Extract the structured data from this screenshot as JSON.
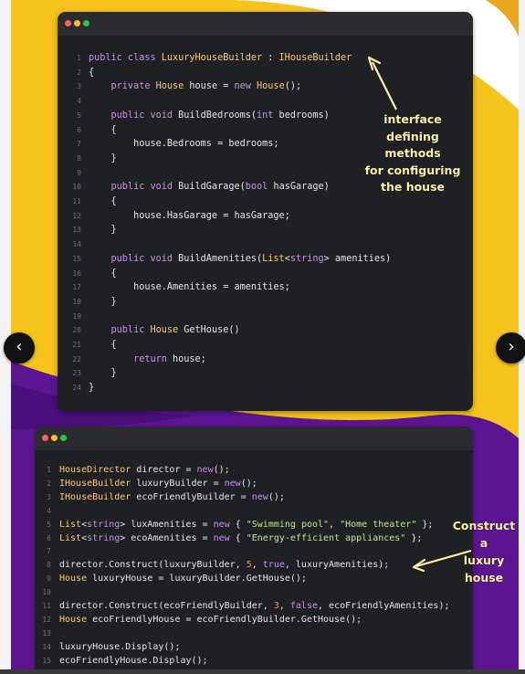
{
  "colors": {
    "yellow_bg": "#f6c21c",
    "purple_bg": "#5b1591",
    "editor_bg": "#1f2024"
  },
  "window1": {
    "lines": [
      {
        "n": "1",
        "segs": [
          [
            "kw",
            "public class "
          ],
          [
            "cls",
            "LuxuryHouseBuilder"
          ],
          [
            "fn",
            " : "
          ],
          [
            "cls",
            "IHouseBuilder"
          ]
        ]
      },
      {
        "n": "2",
        "segs": [
          [
            "fn",
            "{"
          ]
        ]
      },
      {
        "n": "3",
        "segs": [
          [
            "kw",
            "    private "
          ],
          [
            "cls",
            "House"
          ],
          [
            "fn",
            " house = "
          ],
          [
            "kw",
            "new "
          ],
          [
            "cls",
            "House"
          ],
          [
            "fn",
            "();"
          ]
        ]
      },
      {
        "n": "4",
        "segs": []
      },
      {
        "n": "5",
        "segs": [
          [
            "kw",
            "    public void "
          ],
          [
            "fn",
            "BuildBedrooms("
          ],
          [
            "kw",
            "int"
          ],
          [
            "fn",
            " bedrooms)"
          ]
        ]
      },
      {
        "n": "6",
        "segs": [
          [
            "fn",
            "    {"
          ]
        ]
      },
      {
        "n": "7",
        "segs": [
          [
            "fn",
            "        house.Bedrooms = bedrooms;"
          ]
        ]
      },
      {
        "n": "8",
        "segs": [
          [
            "fn",
            "    }"
          ]
        ]
      },
      {
        "n": "9",
        "segs": []
      },
      {
        "n": "10",
        "segs": [
          [
            "kw",
            "    public void "
          ],
          [
            "fn",
            "BuildGarage("
          ],
          [
            "kw",
            "bool"
          ],
          [
            "fn",
            " hasGarage)"
          ]
        ]
      },
      {
        "n": "11",
        "segs": [
          [
            "fn",
            "    {"
          ]
        ]
      },
      {
        "n": "12",
        "segs": [
          [
            "fn",
            "        house.HasGarage = hasGarage;"
          ]
        ]
      },
      {
        "n": "13",
        "segs": [
          [
            "fn",
            "    }"
          ]
        ]
      },
      {
        "n": "14",
        "segs": []
      },
      {
        "n": "15",
        "segs": [
          [
            "kw",
            "    public void "
          ],
          [
            "fn",
            "BuildAmenities("
          ],
          [
            "cls",
            "List"
          ],
          [
            "fn",
            "<"
          ],
          [
            "kw",
            "string"
          ],
          [
            "fn",
            "> amenities)"
          ]
        ]
      },
      {
        "n": "16",
        "segs": [
          [
            "fn",
            "    {"
          ]
        ]
      },
      {
        "n": "17",
        "segs": [
          [
            "fn",
            "        house.Amenities = amenities;"
          ]
        ]
      },
      {
        "n": "18",
        "segs": [
          [
            "fn",
            "    }"
          ]
        ]
      },
      {
        "n": "19",
        "segs": []
      },
      {
        "n": "20",
        "segs": [
          [
            "kw",
            "    public "
          ],
          [
            "cls",
            "House"
          ],
          [
            "fn",
            " GetHouse()"
          ]
        ]
      },
      {
        "n": "21",
        "segs": [
          [
            "fn",
            "    {"
          ]
        ]
      },
      {
        "n": "22",
        "segs": [
          [
            "kw",
            "        return"
          ],
          [
            "fn",
            " house;"
          ]
        ]
      },
      {
        "n": "23",
        "segs": [
          [
            "fn",
            "    }"
          ]
        ]
      },
      {
        "n": "24",
        "segs": [
          [
            "fn",
            "}"
          ]
        ]
      }
    ]
  },
  "window2": {
    "lines": [
      {
        "n": "1",
        "segs": [
          [
            "cls",
            "HouseDirector"
          ],
          [
            "fn",
            " director = "
          ],
          [
            "kw",
            "new"
          ],
          [
            "fn",
            "();"
          ]
        ]
      },
      {
        "n": "2",
        "segs": [
          [
            "cls",
            "IHouseBuilder"
          ],
          [
            "fn",
            " luxuryBuilder = "
          ],
          [
            "kw",
            "new"
          ],
          [
            "fn",
            "();"
          ]
        ]
      },
      {
        "n": "3",
        "segs": [
          [
            "cls",
            "IHouseBuilder"
          ],
          [
            "fn",
            " ecoFriendlyBuilder = "
          ],
          [
            "kw",
            "new"
          ],
          [
            "fn",
            "();"
          ]
        ]
      },
      {
        "n": "4",
        "segs": []
      },
      {
        "n": "5",
        "segs": [
          [
            "cls",
            "List"
          ],
          [
            "fn",
            "<"
          ],
          [
            "kw",
            "string"
          ],
          [
            "fn",
            "> luxAmenities = "
          ],
          [
            "kw",
            "new"
          ],
          [
            "fn",
            " { "
          ],
          [
            "st",
            "\"Swimming pool\""
          ],
          [
            "fn",
            ", "
          ],
          [
            "st",
            "\"Home theater\""
          ],
          [
            "fn",
            " };"
          ]
        ]
      },
      {
        "n": "6",
        "segs": [
          [
            "cls",
            "List"
          ],
          [
            "fn",
            "<"
          ],
          [
            "kw",
            "string"
          ],
          [
            "fn",
            "> ecoAmenities = "
          ],
          [
            "kw",
            "new"
          ],
          [
            "fn",
            " { "
          ],
          [
            "st",
            "\"Energy-efficient appliances\""
          ],
          [
            "fn",
            " };"
          ]
        ]
      },
      {
        "n": "7",
        "segs": []
      },
      {
        "n": "8",
        "segs": [
          [
            "fn",
            "director.Construct(luxuryBuilder, "
          ],
          [
            "num",
            "5"
          ],
          [
            "fn",
            ", "
          ],
          [
            "kw",
            "true"
          ],
          [
            "fn",
            ", luxuryAmenities);"
          ]
        ]
      },
      {
        "n": "9",
        "segs": [
          [
            "cls",
            "House"
          ],
          [
            "fn",
            " luxuryHouse = luxuryBuilder.GetHouse();"
          ]
        ]
      },
      {
        "n": "10",
        "segs": []
      },
      {
        "n": "11",
        "segs": [
          [
            "fn",
            "director.Construct(ecoFriendlyBuilder, "
          ],
          [
            "num",
            "3"
          ],
          [
            "fn",
            ", "
          ],
          [
            "kw",
            "false"
          ],
          [
            "fn",
            ", ecoFriendlyAmenities);"
          ]
        ]
      },
      {
        "n": "12",
        "segs": [
          [
            "cls",
            "House"
          ],
          [
            "fn",
            " ecoFriendlyHouse = ecoFriendlyBuilder.GetHouse();"
          ]
        ]
      },
      {
        "n": "13",
        "segs": []
      },
      {
        "n": "14",
        "segs": [
          [
            "fn",
            "luxuryHouse.Display();"
          ]
        ]
      },
      {
        "n": "15",
        "segs": [
          [
            "fn",
            "ecoFriendlyHouse.Display();"
          ]
        ]
      }
    ]
  },
  "annotations": {
    "note1_lines": [
      "interface",
      "defining methods",
      "for configuring",
      "the house"
    ],
    "note2_lines": [
      "Construct a",
      "luxury",
      "house"
    ]
  },
  "nav": {
    "prev_icon": "‹",
    "next_icon": "›"
  }
}
